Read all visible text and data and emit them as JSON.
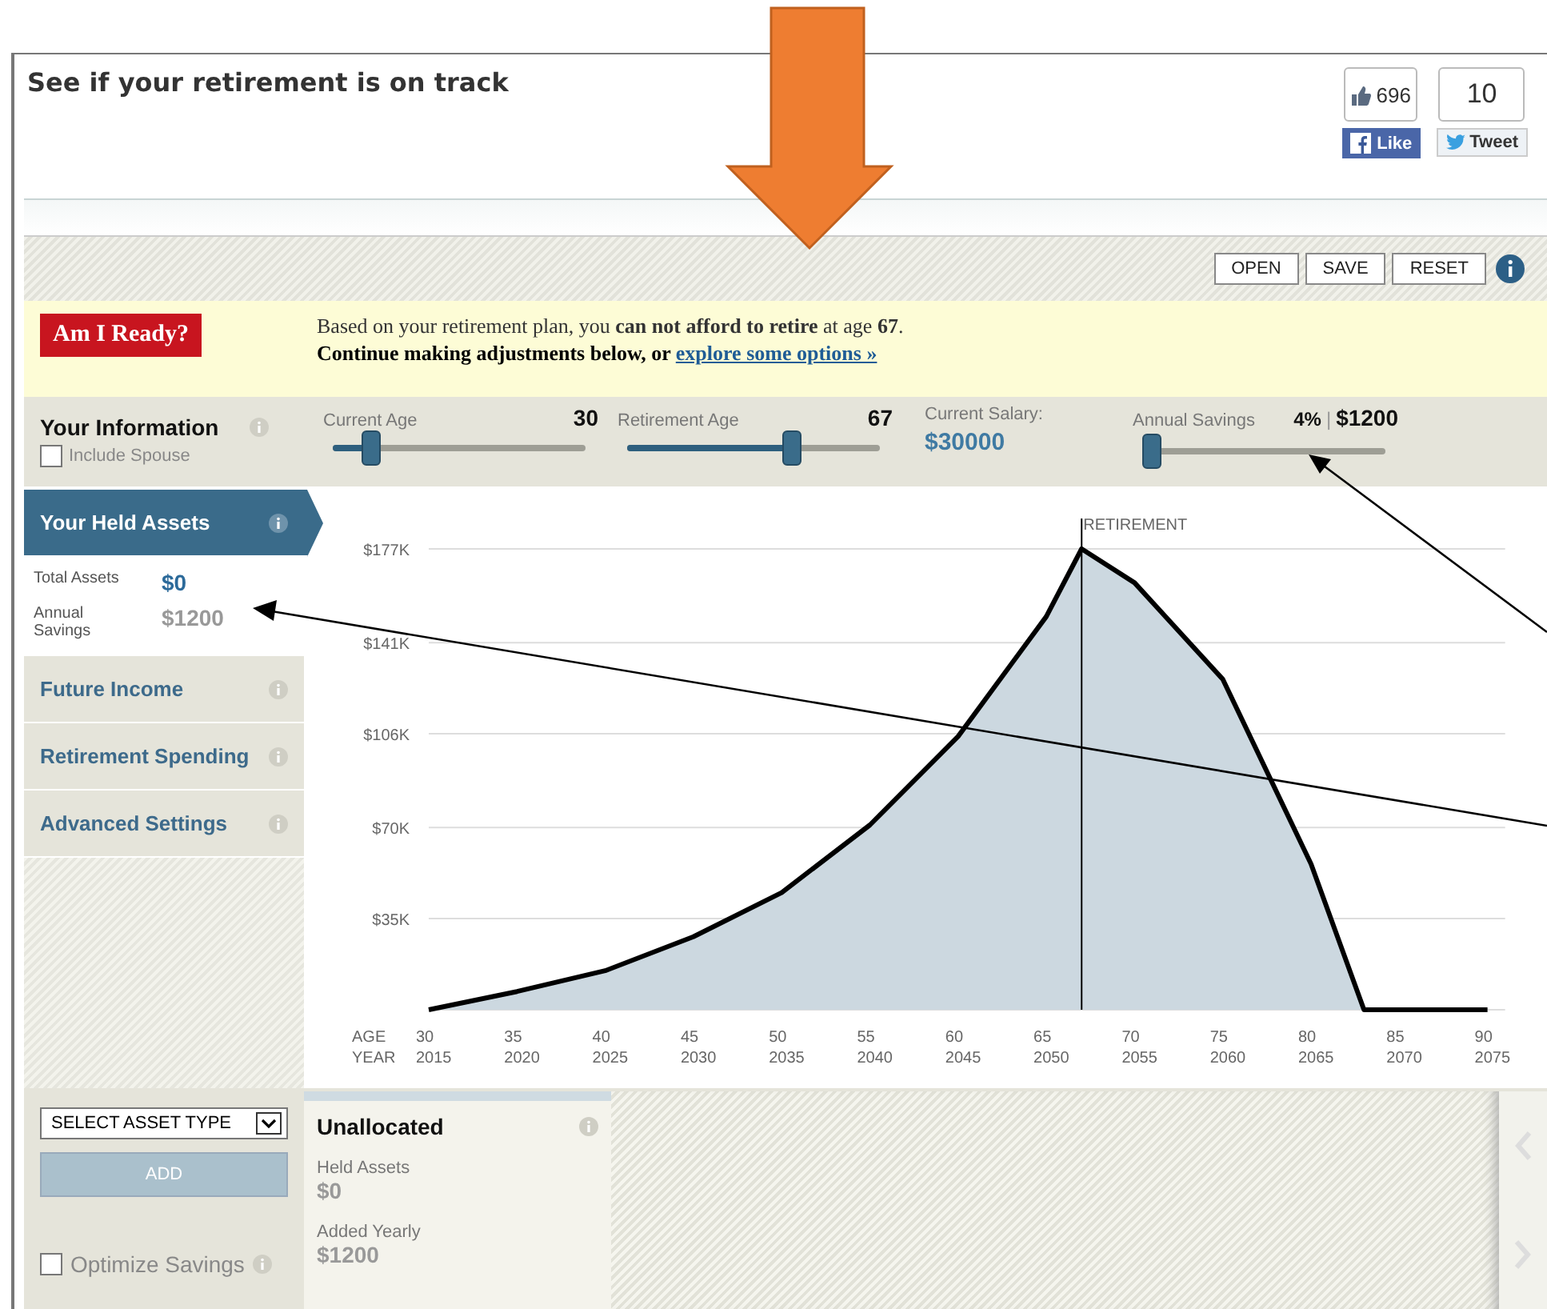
{
  "header": {
    "title": "See if your retirement is on track",
    "social": [
      {
        "kind": "facebook",
        "count": "696",
        "label": "Like"
      },
      {
        "kind": "twitter",
        "count": "10",
        "label": "Tweet"
      }
    ]
  },
  "toolbar": {
    "buttons": [
      "OPEN",
      "SAVE",
      "RESET"
    ]
  },
  "banner": {
    "badge": "Am I Ready?",
    "message": "Based on your retirement plan, you **can not afford to retire** at age **67**.",
    "followup": "Continue making adjustments below, or ",
    "link": "explore some options »"
  },
  "info_bar": {
    "title": "Your Information",
    "spouse": {
      "label": "Include Spouse",
      "checked": false
    },
    "controls": [
      {
        "kind": "slider",
        "label": "Current Age",
        "value": "30",
        "level": 0.15
      },
      {
        "kind": "slider",
        "label": "Retirement Age",
        "value": "67",
        "level": 0.65
      },
      {
        "kind": "readout",
        "label": "Current Salary:",
        "value": "$30000"
      },
      {
        "kind": "savings",
        "label": "Annual Savings",
        "percent": "4%",
        "separator": "|",
        "value": "$1200",
        "level": 0.04
      }
    ]
  },
  "sidebar": {
    "items": [
      {
        "label": "Your Held Assets",
        "selected": true,
        "details": [
          {
            "label": "Total Assets",
            "value": "$0",
            "kind": "total"
          },
          {
            "label": "Annual Savings",
            "value": "$1200",
            "kind": "savings"
          }
        ]
      },
      {
        "label": "Future Income",
        "selected": false
      },
      {
        "label": "Retirement Spending",
        "selected": false
      },
      {
        "label": "Advanced Settings",
        "selected": false
      }
    ]
  },
  "chart": {
    "age_label": "AGE",
    "year_label": "YEAR",
    "years": [
      "2015",
      "2020",
      "2025",
      "2030",
      "2035",
      "2040",
      "2045",
      "2050",
      "2055",
      "2060",
      "2065",
      "2070",
      "2075"
    ],
    "chart_data": {
      "type": "area",
      "x": [
        30,
        35,
        40,
        45,
        50,
        55,
        60,
        65,
        67,
        70,
        75,
        80,
        83,
        85,
        90
      ],
      "series": [
        {
          "color": "#ccd8e0",
          "values": [
            0,
            7,
            15,
            28,
            45,
            71,
            105,
            151,
            177,
            164,
            127,
            56,
            0,
            0,
            0
          ]
        }
      ],
      "xlim": [
        30,
        91
      ],
      "ylim": [
        0,
        177
      ],
      "grid": true,
      "xticks": [
        30,
        35,
        40,
        45,
        50,
        55,
        60,
        65,
        70,
        75,
        80,
        85,
        90
      ],
      "yticks": [
        {
          "value": 35,
          "label": "$35K"
        },
        {
          "value": 70,
          "label": "$70K"
        },
        {
          "value": 106,
          "label": "$106K"
        },
        {
          "value": 141,
          "label": "$141K"
        },
        {
          "value": 177,
          "label": "$177K"
        }
      ],
      "ref_lines": [
        {
          "axis": "x",
          "value": 67,
          "label": "RETIREMENT"
        }
      ]
    }
  },
  "assets_panel": {
    "select": "SELECT ASSET TYPE",
    "add": "ADD",
    "optimize": {
      "label": "Optimize Savings",
      "checked": false
    },
    "card": {
      "title": "Unallocated",
      "fields": [
        {
          "label": "Held Assets",
          "value": "$0"
        },
        {
          "label": "Added Yearly",
          "value": "$1200"
        }
      ]
    }
  }
}
